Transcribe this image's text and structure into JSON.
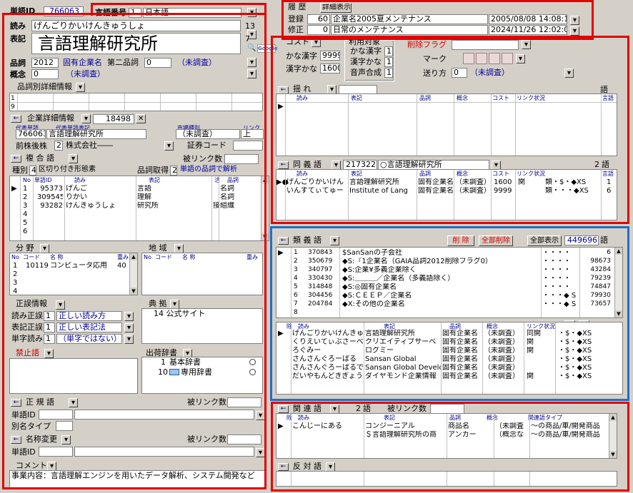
{
  "word_id": {
    "label": "単語ID",
    "value": "766063"
  },
  "lang": {
    "label": "言語番号",
    "num": "1",
    "name": "日本語"
  },
  "yomi": {
    "label": "読み",
    "value": "げんごりかいけんきゅうしょ",
    "count": "13"
  },
  "hyoki": {
    "label": "表記",
    "value": "言語理解研究所",
    "count": "7"
  },
  "hinshi": {
    "label": "品詞",
    "num": "2012",
    "name": "固有企業名",
    "second_label": "第二品詞",
    "second_num": "0",
    "second_name": "（未調査）"
  },
  "gainen": {
    "label": "概念",
    "num": "0",
    "name": "（未調査）"
  },
  "cost": {
    "label": "コスト"
  },
  "kana": {
    "label1": "かな漢字",
    "val1": "9999",
    "label2": "漢字かな",
    "val2": "1600"
  },
  "riyou": {
    "title": "利用対象",
    "items": [
      {
        "label": "かな漢字",
        "val": "1"
      },
      {
        "label": "漢字かな",
        "val": "1"
      },
      {
        "label": "音声合成",
        "val": "1"
      }
    ]
  },
  "flags": {
    "sakujo": "削除フラグ",
    "mark": "マーク",
    "okuri": "送り方",
    "okuri_num": "0",
    "okuri_name": "（未調査）"
  },
  "history": {
    "title": "履 歴",
    "button": "詳細表示",
    "rows": [
      {
        "label": "登録",
        "num": "60",
        "text": "企業名2005夏メンテナンス",
        "date": "2005/08/08 14:08:12"
      },
      {
        "label": "修正",
        "num": "0",
        "text": "日常のメンテナンス",
        "date": "2024/11/26 12:02:00"
      }
    ]
  },
  "hinshi_detail": {
    "title": "品詞別詳細情報",
    "row_labels": [
      "1",
      "9"
    ]
  },
  "company": {
    "title": "企業詳細情報",
    "count": "18498",
    "h_daihyo_tango": "代表単語",
    "h_daihyo_hyoki": "代表単語表記",
    "h_market": "市場種別",
    "h_link": "リンク",
    "daihyo_id": "766063",
    "daihyo_name": "言語理解研究所",
    "market": "（未調査）",
    "link": "上",
    "zengo_label": "前株後株",
    "zengo_num": "2",
    "zengo_name": "株式会社――",
    "code_label": "証券コード"
  },
  "compound": {
    "title": "複 合 語",
    "backlink": "被リンク数",
    "kind_label": "種別",
    "kind_num": "4",
    "kind_name": "区切り付き形態素",
    "hinshi_label": "品詞取得",
    "hinshi_num": "2",
    "hinshi_name": "単語の品詞で解析",
    "headers": [
      "No",
      "単語ID",
      "読み",
      "表記",
      "活",
      "品詞"
    ],
    "rows": [
      {
        "no": "1",
        "id": "95373",
        "yomi": "げんご",
        "hyoki": "言語",
        "katsu": "",
        "hinshi": "名詞"
      },
      {
        "no": "2",
        "id": "309545",
        "yomi": "りかい",
        "hyoki": "理解",
        "katsu": "",
        "hinshi": "名詞"
      },
      {
        "no": "3",
        "id": "93282",
        "yomi": "けんきゅうしょ",
        "hyoki": "研究所",
        "katsu": "接",
        "hinshi": "組織"
      },
      {
        "no": "4"
      },
      {
        "no": "5"
      },
      {
        "no": "6"
      }
    ]
  },
  "bunya": {
    "title": "分 野",
    "headers": [
      "No",
      "コード",
      "名 称",
      "重み"
    ],
    "rows": [
      {
        "no": "1",
        "code": "10119",
        "name": "コンピュータ応用",
        "weight": "40"
      },
      {
        "no": "2"
      },
      {
        "no": "3"
      },
      {
        "no": "4"
      }
    ]
  },
  "chiiki": {
    "title": "地 域",
    "headers": [
      "No",
      "コード",
      "名 称",
      "重み"
    ]
  },
  "seikai": {
    "title": "正誤情報",
    "rows": [
      {
        "label": "読み正誤",
        "num": "1",
        "text": "正しい読み方"
      },
      {
        "label": "表記正誤",
        "num": "1",
        "text": "正しい表記法"
      },
      {
        "label": "単字読み",
        "num": "1",
        "text": "（単字ではない）"
      }
    ]
  },
  "tenkyo": {
    "title": "典 拠",
    "text": "14 公式サイト"
  },
  "kinshi": {
    "title": "禁止語"
  },
  "shukka": {
    "title": "出荷辞書",
    "rows": [
      {
        "no": "1",
        "name": "基本辞書"
      },
      {
        "no": "10",
        "name": "専用辞書"
      }
    ]
  },
  "seikigo": {
    "title": "正 規 語",
    "backlink": "被リンク数",
    "id_label": "単語ID",
    "type_label": "別名タイプ"
  },
  "meisho": {
    "title": "名称変更",
    "backlink": "被リンク数",
    "id_label": "単語ID"
  },
  "comment": {
    "title": "コメント",
    "text": "事業内容：言語理解エンジンを用いたデータ解析、システム開発など"
  },
  "yure": {
    "title": "揺 れ",
    "count_label": "語",
    "headers": [
      "読み",
      "表記",
      "品詞",
      "概念",
      "コスト",
      "リンク状況",
      "言語"
    ]
  },
  "doudou": {
    "title": "同 義 語",
    "id": "217322",
    "name": "○言語理解研究所",
    "count": "2",
    "unit": "語",
    "headers": [
      "読み",
      "表記",
      "品詞",
      "概念",
      "コスト",
      "リンク状況",
      "言語"
    ],
    "rows": [
      {
        "mark": "▶●",
        "yomi": "げんごりかいけん",
        "hyoki": "言語理解研究所",
        "hinshi": "固有企業名",
        "gainen": "（未調査）",
        "cost": "1600",
        "status": "関",
        "link": "類・$・◆XS",
        "lang": "1"
      },
      {
        "mark": "",
        "yomi": "いんすてぃてゅー",
        "hyoki": "Institute of Lang",
        "hinshi": "固有企業名",
        "gainen": "（未調査）",
        "cost": "9999",
        "status": "",
        "link": "類・・・◆XS",
        "lang": "6"
      }
    ]
  },
  "ruigi": {
    "title": "類 義 語",
    "del": "削 除",
    "del_all": "全部削除",
    "show_all": "全部表示",
    "count": "449696",
    "unit": "語",
    "rows": [
      {
        "no": "1",
        "id": "370843",
        "text": "$SanSanの子会社",
        "link": "・・・・",
        "val": "6"
      },
      {
        "no": "2",
        "id": "350679",
        "text": "◆S:『1企業名（GAIA品詞2012削除フラグ0）",
        "link": "・・・・",
        "val": "98673"
      },
      {
        "no": "3",
        "id": "340797",
        "text": "◆S:企業¥多義企業除く",
        "link": "・・・・",
        "val": "43284"
      },
      {
        "no": "4",
        "id": "330430",
        "text": "◆S:＿＿＿／企業名（多義語除く）",
        "link": "・・・・",
        "val": "79239"
      },
      {
        "no": "5",
        "id": "314848",
        "text": "◆S:◎固有企業名",
        "link": "・・・・",
        "val": "74847"
      },
      {
        "no": "6",
        "id": "304456",
        "text": "◆S:ＣＥＥＰ／企業名",
        "link": "・・・◆ S",
        "val": "79930"
      },
      {
        "no": "7",
        "id": "204784",
        "text": "◆X:その他の企業名",
        "link": "・・・◆ S",
        "val": "73657"
      },
      {
        "no": "8",
        "id": "",
        "text": "",
        "link": "",
        "val": ""
      }
    ],
    "sub_headers": [
      "除",
      "読み",
      "表記",
      "品詞",
      "概念",
      "リンク状況"
    ],
    "sub_rows": [
      {
        "yomi": "げんごりかいけんきゅ",
        "hyoki": "言語理解研究所",
        "hinshi": "固有企業名",
        "gainen": "（未調査）",
        "status": "同開",
        "link": "・$・◆XS"
      },
      {
        "yomi": "くりえいてぃぶさーべ",
        "hyoki": "クリエイティブサーベ",
        "hinshi": "固有企業名",
        "gainen": "（未調査）",
        "status": "関",
        "link": "・$・◆XS"
      },
      {
        "yomi": "ろぐみー",
        "hyoki": "ログミー",
        "hinshi": "固有企業名",
        "gainen": "（未調査）",
        "status": "関",
        "link": "・$・◆XS"
      },
      {
        "yomi": "さんさんぐろーばる",
        "hyoki": "Sansan Global",
        "hinshi": "固有企業名",
        "gainen": "（未調査）",
        "status": "",
        "link": "・$・◆XS"
      },
      {
        "yomi": "さんさんぐろーばるで",
        "hyoki": "Sansan Global Develop",
        "hinshi": "固有企業名",
        "gainen": "（未調査）",
        "status": "",
        "link": "・$・◆XS"
      },
      {
        "yomi": "だいやもんどきぎょう",
        "hyoki": "ダイヤモンド企業情報",
        "hinshi": "固有企業名",
        "gainen": "（未調査）",
        "status": "関",
        "link": "・$・◆XS"
      }
    ]
  },
  "kanren": {
    "title": "関 連 語",
    "count": "2",
    "unit": "語",
    "backlink": "被リンク数",
    "headers": [
      "除",
      "読み",
      "表記",
      "品詞",
      "概念",
      "関連語タイプ"
    ],
    "rows": [
      {
        "yomi": "こんじーにある",
        "hyoki": "コンジーニアル",
        "hinshi": "商品名",
        "gainen": "（未調査",
        "type": "～の商品/車/開発商品"
      },
      {
        "yomi": "",
        "hyoki": "＄言語理解研究所の商",
        "hinshi": "アンカー",
        "gainen": "（概念な",
        "type": "～の商品/車/開発商品"
      }
    ]
  },
  "hantai": {
    "title": "反 対 語"
  },
  "colors": {
    "red": "#e40000",
    "blue": "#1f6fc5",
    "link": "#00009c"
  }
}
